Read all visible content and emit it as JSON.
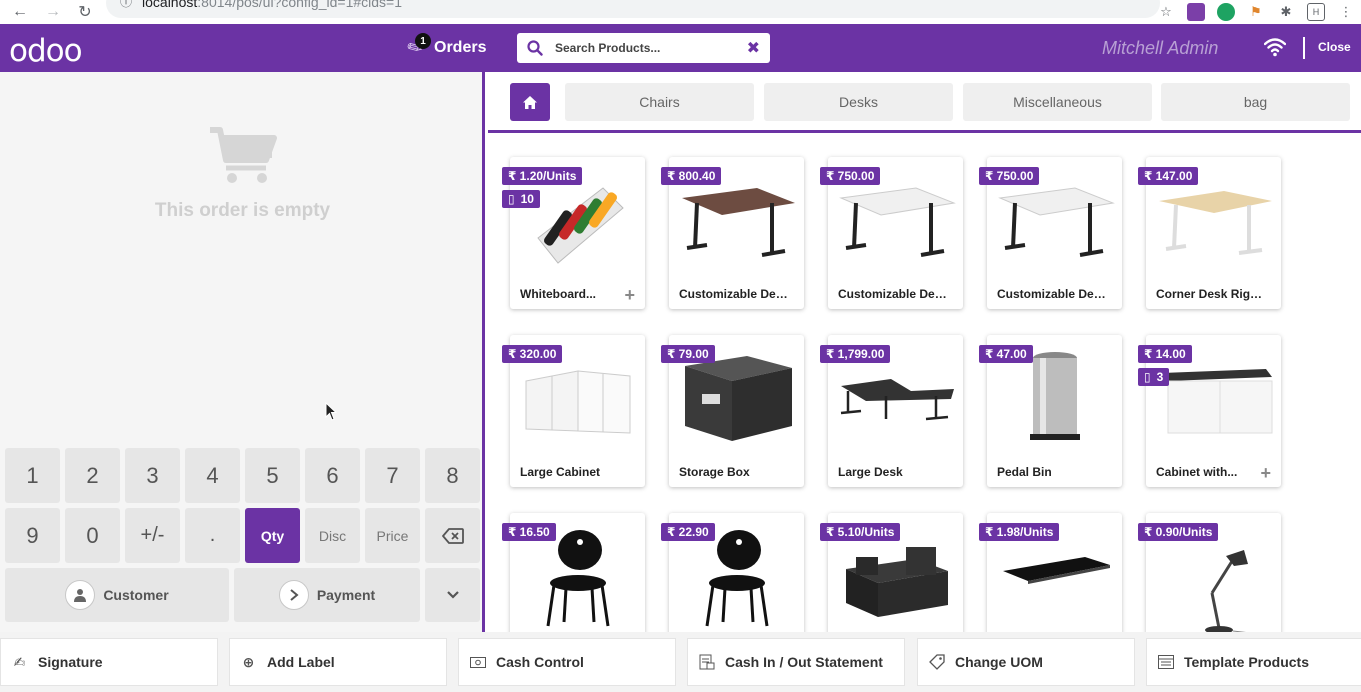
{
  "browser": {
    "url_host": "localhost",
    "url_rest": ":8014/pos/ui?config_id=1#cids=1"
  },
  "header": {
    "logo": "odoo",
    "orders_label": "Orders",
    "orders_count": "1",
    "search_placeholder": "Search Products...",
    "user_name": "Mitchell Admin",
    "close_label": "Close",
    "brand_color": "#6b33a4"
  },
  "order": {
    "empty_text": "This order is empty"
  },
  "numpad": {
    "row1": [
      "1",
      "2",
      "3",
      "4",
      "5",
      "6",
      "7",
      "8"
    ],
    "row2": [
      "9",
      "0",
      "+/-",
      ".",
      "Qty",
      "Disc",
      "Price"
    ],
    "active_mode": "Qty",
    "customer_label": "Customer",
    "payment_label": "Payment"
  },
  "categories": [
    "Chairs",
    "Desks",
    "Miscellaneous",
    "bag"
  ],
  "products": [
    {
      "name": "Whiteboard...",
      "price": "₹ 1.20/Units",
      "qty": "10",
      "plus": true,
      "image": "pens"
    },
    {
      "name": "Customizable Des...",
      "price": "₹ 800.40",
      "image": "desk-dark"
    },
    {
      "name": "Customizable Des...",
      "price": "₹ 750.00",
      "image": "desk-white"
    },
    {
      "name": "Customizable Des...",
      "price": "₹ 750.00",
      "image": "desk-white"
    },
    {
      "name": "Corner Desk Right...",
      "price": "₹ 147.00",
      "image": "desk-corner"
    },
    {
      "name": "Large Cabinet",
      "price": "₹ 320.00",
      "image": "cabinet"
    },
    {
      "name": "Storage Box",
      "price": "₹ 79.00",
      "image": "box"
    },
    {
      "name": "Large Desk",
      "price": "₹ 1,799.00",
      "image": "large-desk"
    },
    {
      "name": "Pedal Bin",
      "price": "₹ 47.00",
      "image": "bin"
    },
    {
      "name": "Cabinet with...",
      "price": "₹ 14.00",
      "qty": "3",
      "plus": true,
      "image": "cabinet-white"
    },
    {
      "name": "",
      "price": "₹ 16.50",
      "image": "chair"
    },
    {
      "name": "",
      "price": "₹ 22.90",
      "image": "chair"
    },
    {
      "name": "",
      "price": "₹ 5.10/Units",
      "image": "organizer"
    },
    {
      "name": "",
      "price": "₹ 1.98/Units",
      "image": "pad"
    },
    {
      "name": "",
      "price": "₹ 0.90/Units",
      "image": "lamp"
    }
  ],
  "controls": [
    {
      "label": "Signature",
      "icon": "signature-icon"
    },
    {
      "label": "Add Label",
      "icon": "plus-circle-icon"
    },
    {
      "label": "Cash Control",
      "icon": "money-icon"
    },
    {
      "label": "Cash In / Out Statement",
      "icon": "statement-icon"
    },
    {
      "label": "Change UOM",
      "icon": "tag-icon"
    },
    {
      "label": "Template Products",
      "icon": "list-icon"
    }
  ]
}
